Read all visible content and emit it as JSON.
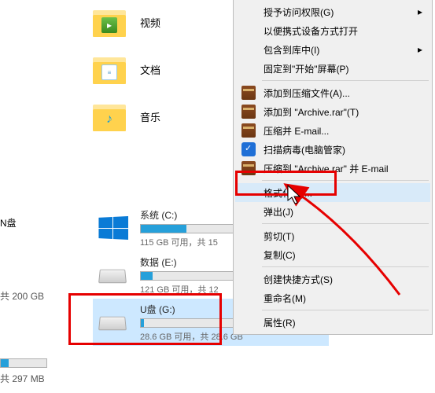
{
  "folders": [
    {
      "label": "视频"
    },
    {
      "label": "文档"
    },
    {
      "label": "音乐"
    }
  ],
  "sidebar": {
    "frag1": "N盘",
    "cap1": "共 200 GB",
    "cap2": "共 297 MB"
  },
  "drives": [
    {
      "name": "系统 (C:)",
      "cap": "115 GB 可用，共 15"
    },
    {
      "name": "数据 (E:)",
      "cap": "121 GB 可用，共 12"
    },
    {
      "name": "U盘 (G:)",
      "cap": "28.6 GB 可用，共 28.6 GB"
    }
  ],
  "menu": [
    "授予访问权限(G)",
    "以便携式设备方式打开",
    "包含到库中(I)",
    "固定到\"开始\"屏幕(P)",
    "添加到压缩文件(A)...",
    "添加到 \"Archive.rar\"(T)",
    "压缩并 E-mail...",
    "扫描病毒(电脑管家)",
    "压缩到 \"Archive.rar\" 并 E-mail",
    "格式化(A)...",
    "弹出(J)",
    "剪切(T)",
    "复制(C)",
    "创建快捷方式(S)",
    "重命名(M)",
    "属性(R)"
  ]
}
